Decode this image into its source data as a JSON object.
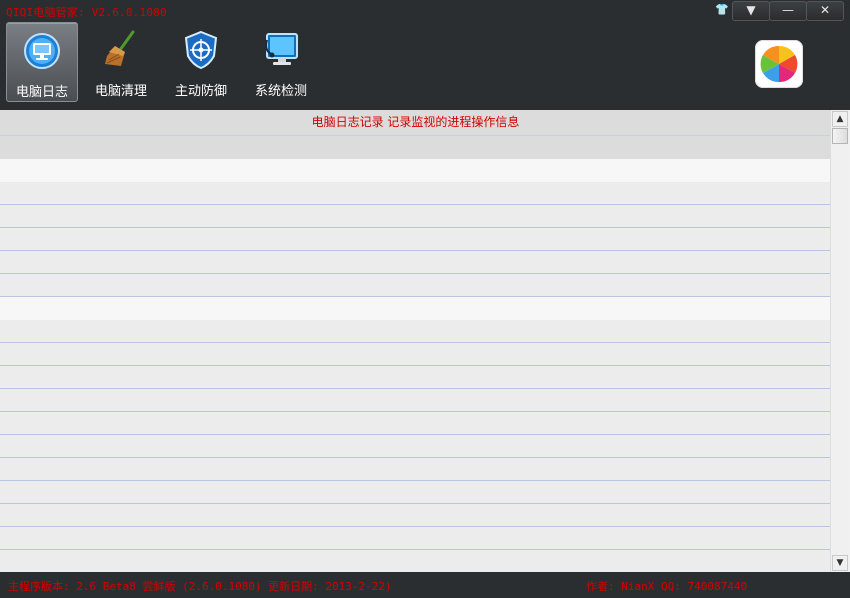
{
  "window": {
    "title": "QIQI电脑管家: V2.6.0.1080",
    "skin_icon": "tshirt-icon",
    "menu_icon": "menu-down-icon",
    "min_icon": "minimize-icon",
    "close_icon": "close-icon",
    "skin_glyph": "👕",
    "menu_glyph": "▼",
    "min_glyph": "—",
    "close_glyph": "✕"
  },
  "toolbar": {
    "items": [
      {
        "label": "电脑日志",
        "icon": "monitor-icon",
        "active": true
      },
      {
        "label": "电脑清理",
        "icon": "broom-icon",
        "active": false
      },
      {
        "label": "主动防御",
        "icon": "shield-icon",
        "active": false
      },
      {
        "label": "系统检测",
        "icon": "system-check-icon",
        "active": false
      }
    ],
    "brand_icon": "colorful-logo-icon"
  },
  "log_panel": {
    "header": "电脑日志记录 记录监视的进程操作信息",
    "rows": [
      "",
      "",
      "",
      "",
      "",
      "",
      "",
      "",
      "",
      "",
      "",
      "",
      "",
      "",
      "",
      "",
      "",
      "",
      ""
    ]
  },
  "statusbar": {
    "version_text": "主程序版本: 2.6 Beta8 尝鲜版 (2.6.0.1080) 更新日期: 2013-2-22)",
    "author_text": "作者: NianX    QQ: 740087440"
  },
  "colors": {
    "accent_red": "#d40000",
    "chrome": "#2b2e31",
    "row_line": "#b8c6df"
  }
}
